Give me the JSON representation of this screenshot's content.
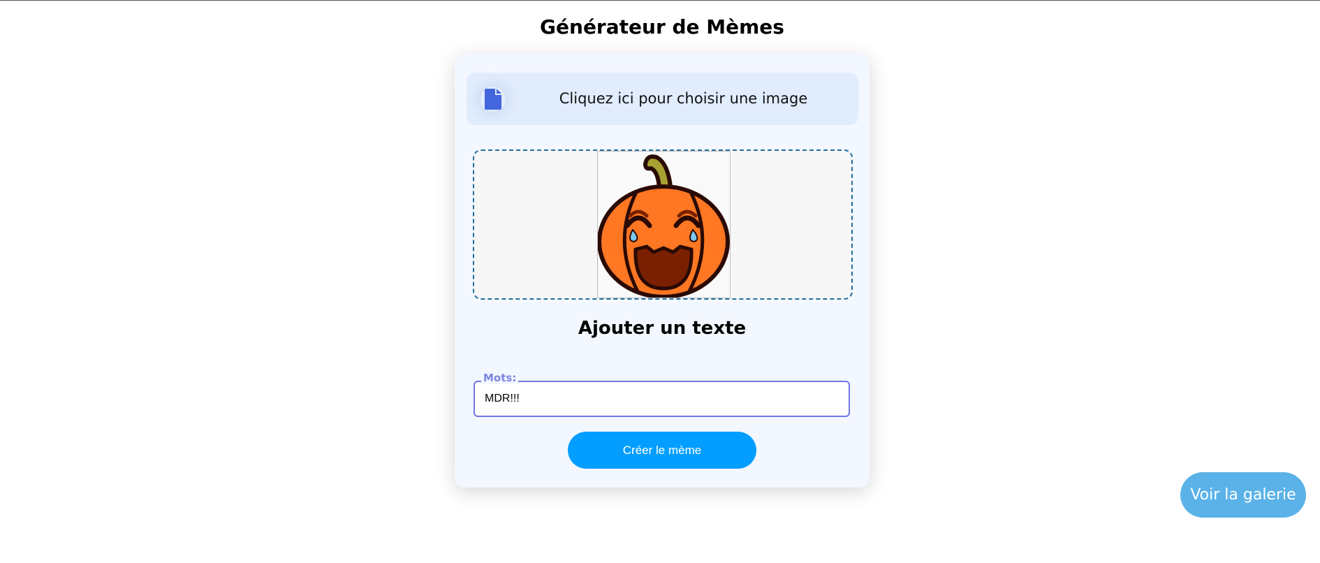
{
  "header": {
    "title": "Générateur de Mèmes"
  },
  "file_picker": {
    "label": "Cliquez ici pour choisir une image",
    "icon": "file-icon"
  },
  "preview": {
    "image": "laughing-pumpkin-emoji"
  },
  "text_section": {
    "title": "Ajouter un texte",
    "field_label": "Mots:",
    "field_value": "MDR!!!"
  },
  "actions": {
    "create_label": "Créer le mème",
    "gallery_label": "Voir la galerie"
  },
  "colors": {
    "accent_blue": "#039eff",
    "gallery_blue": "#5bb2e8",
    "input_border": "#6e78e6",
    "file_icon": "#4466dd",
    "pumpkin_orange": "#ff7722"
  }
}
